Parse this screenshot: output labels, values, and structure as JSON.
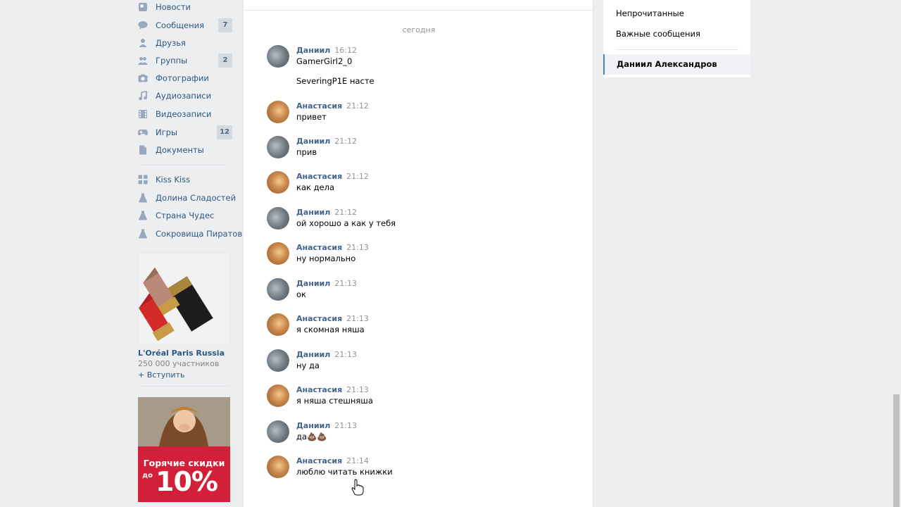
{
  "nav": {
    "items": [
      {
        "label": "Новости",
        "icon": "news-icon"
      },
      {
        "label": "Сообщения",
        "icon": "message-icon",
        "count": "7"
      },
      {
        "label": "Друзья",
        "icon": "friends-icon"
      },
      {
        "label": "Группы",
        "icon": "groups-icon",
        "count": "2"
      },
      {
        "label": "Фотографии",
        "icon": "camera-icon"
      },
      {
        "label": "Аудиозаписи",
        "icon": "music-icon"
      },
      {
        "label": "Видеозаписи",
        "icon": "video-icon"
      },
      {
        "label": "Игры",
        "icon": "gamepad-icon",
        "count": "12"
      },
      {
        "label": "Документы",
        "icon": "document-icon"
      }
    ],
    "apps": [
      {
        "label": "Kiss Kiss",
        "icon": "apps-grid-icon"
      },
      {
        "label": "Долина Сладостей",
        "icon": "flask-icon"
      },
      {
        "label": "Страна Чудес",
        "icon": "flask-icon"
      },
      {
        "label": "Сокровища Пиратов",
        "icon": "flask-icon"
      }
    ]
  },
  "ad": {
    "title": "L'Oréal Paris Russia",
    "members": "250 000 участников",
    "join": "+ Вступить"
  },
  "ad2": {
    "line1": "Горячие скидки",
    "line2": "до",
    "line3": "10%"
  },
  "chat": {
    "day_label": "сегодня",
    "messages": [
      {
        "author": "Даниил",
        "time": "16:12",
        "text": "GamerGirl2_0",
        "extra": "SeveringP1E насте"
      },
      {
        "author": "Анастасия",
        "time": "21:12",
        "text": "привет"
      },
      {
        "author": "Даниил",
        "time": "21:12",
        "text": "прив"
      },
      {
        "author": "Анастасия",
        "time": "21:12",
        "text": "как дела"
      },
      {
        "author": "Даниил",
        "time": "21:12",
        "text": "ой хорошо а как у тебя"
      },
      {
        "author": "Анастасия",
        "time": "21:13",
        "text": "ну нормально"
      },
      {
        "author": "Даниил",
        "time": "21:13",
        "text": "ок"
      },
      {
        "author": "Анастасия",
        "time": "21:13",
        "text": "я скомная няша"
      },
      {
        "author": "Даниил",
        "time": "21:13",
        "text": "ну да"
      },
      {
        "author": "Анастасия",
        "time": "21:13",
        "text": "я няша стешняша"
      },
      {
        "author": "Даниил",
        "time": "21:13",
        "text": "да💩💩"
      },
      {
        "author": "Анастасия",
        "time": "21:14",
        "text": "люблю читать книжки"
      }
    ]
  },
  "right_panel": {
    "unread": "Непрочитанные",
    "important": "Важные сообщения",
    "active_dialog": "Даниил Александров"
  },
  "colors": {
    "link": "#2a5885",
    "author": "#42648b",
    "accent": "#5181b8",
    "background": "#edeef0"
  }
}
